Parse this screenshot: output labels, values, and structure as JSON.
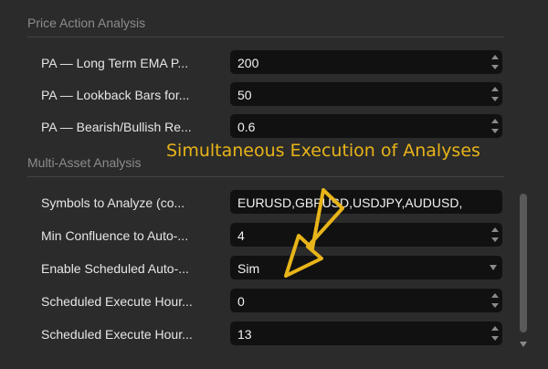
{
  "sections": {
    "price_action": "Price Action Analysis",
    "multi_asset": "Multi-Asset Analysis"
  },
  "rows": [
    {
      "label": "PA — Long Term EMA P...",
      "value": "200",
      "control": "spinner"
    },
    {
      "label": "PA — Lookback Bars for...",
      "value": "50",
      "control": "spinner"
    },
    {
      "label": "PA — Bearish/Bullish Re...",
      "value": "0.6",
      "control": "spinner"
    },
    {
      "label": "Symbols to Analyze (co...",
      "value": "EURUSD,GBPUSD,USDJPY,AUDUSD,",
      "control": "text"
    },
    {
      "label": "Min Confluence to Auto-...",
      "value": "4",
      "control": "spinner"
    },
    {
      "label": "Enable Scheduled Auto-...",
      "value": "Sim",
      "control": "dropdown"
    },
    {
      "label": "Scheduled Execute Hour...",
      "value": "0",
      "control": "spinner"
    },
    {
      "label": "Scheduled Execute Hour...",
      "value": "13",
      "control": "spinner"
    }
  ],
  "annotation": {
    "text": "Simultaneous Execution of Analyses",
    "color": "#e8b419",
    "arrow_color": "#e8b419"
  },
  "icons": {
    "spinner": "spinner-arrows-icon",
    "dropdown": "chevron-down-icon",
    "scroll": "scroll-down-icon"
  }
}
